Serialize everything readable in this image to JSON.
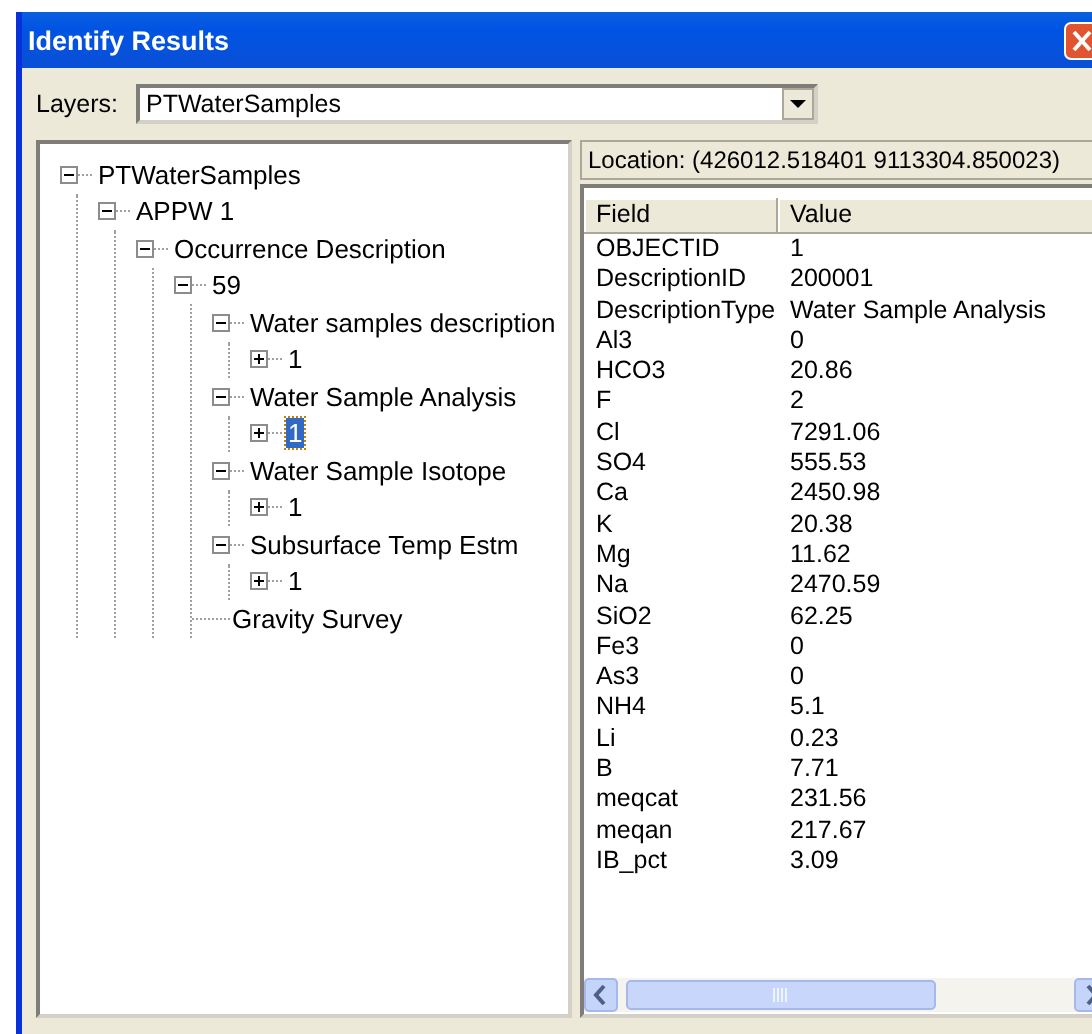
{
  "window": {
    "title": "Identify Results"
  },
  "layers": {
    "label": "Layers:",
    "value": "PTWaterSamples"
  },
  "tree": [
    {
      "label": "PTWaterSamples",
      "expanded": true,
      "selected": false,
      "children": [
        {
          "label": "APPW 1",
          "expanded": true,
          "selected": false,
          "children": [
            {
              "label": "Occurrence Description",
              "expanded": true,
              "selected": false,
              "children": [
                {
                  "label": "59",
                  "expanded": true,
                  "selected": false,
                  "children": [
                    {
                      "label": "Water samples description",
                      "expanded": true,
                      "selected": false,
                      "children": [
                        {
                          "label": "1",
                          "expanded": false,
                          "selected": false
                        }
                      ]
                    },
                    {
                      "label": "Water Sample Analysis",
                      "expanded": true,
                      "selected": false,
                      "children": [
                        {
                          "label": "1",
                          "expanded": false,
                          "selected": true
                        }
                      ]
                    },
                    {
                      "label": "Water Sample Isotope",
                      "expanded": true,
                      "selected": false,
                      "children": [
                        {
                          "label": "1",
                          "expanded": false,
                          "selected": false
                        }
                      ]
                    },
                    {
                      "label": "Subsurface Temp Estm",
                      "expanded": true,
                      "selected": false,
                      "children": [
                        {
                          "label": "1",
                          "expanded": false,
                          "selected": false
                        }
                      ]
                    },
                    {
                      "label": "Gravity Survey",
                      "selected": false
                    }
                  ]
                }
              ]
            }
          ]
        }
      ]
    }
  ],
  "location": "Location: (426012.518401 9113304.850023)",
  "table": {
    "columns": [
      "Field",
      "Value"
    ],
    "rows": [
      [
        "OBJECTID",
        "1"
      ],
      [
        "DescriptionID",
        "200001"
      ],
      [
        "DescriptionType",
        "Water Sample Analysis"
      ],
      [
        "Al3",
        "0"
      ],
      [
        "HCO3",
        "20.86"
      ],
      [
        "F",
        "2"
      ],
      [
        "Cl",
        "7291.06"
      ],
      [
        "SO4",
        "555.53"
      ],
      [
        "Ca",
        "2450.98"
      ],
      [
        "K",
        "20.38"
      ],
      [
        "Mg",
        "11.62"
      ],
      [
        "Na",
        "2470.59"
      ],
      [
        "SiO2",
        "62.25"
      ],
      [
        "Fe3",
        "0"
      ],
      [
        "As3",
        "0"
      ],
      [
        "NH4",
        "5.1"
      ],
      [
        "Li",
        "0.23"
      ],
      [
        "B",
        "7.71"
      ],
      [
        "meqcat",
        "231.56"
      ],
      [
        "meqan",
        "217.67"
      ],
      [
        "IB_pct",
        "3.09"
      ]
    ]
  }
}
